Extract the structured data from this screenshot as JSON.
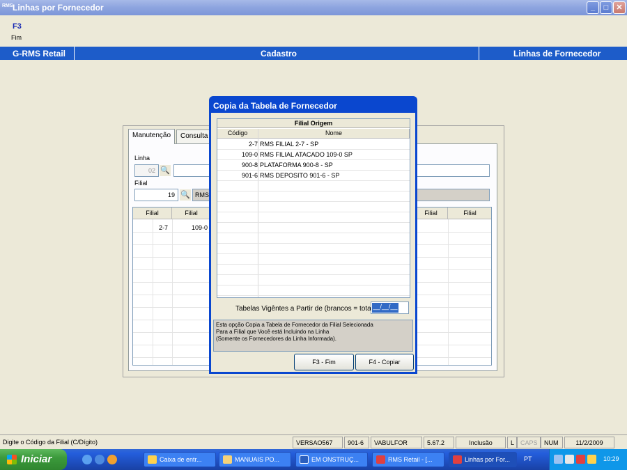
{
  "window": {
    "app_icon_text": "RMS",
    "title": "Linhas por Fornecedor",
    "minimize": "_",
    "maximize": "□",
    "close": "✕"
  },
  "function_key": {
    "key": "F3",
    "description": "Fim"
  },
  "header": {
    "left": "G-RMS Retail",
    "center": "Cadastro",
    "right": "Linhas de Fornecedor"
  },
  "tabs": [
    {
      "label": "Manutenção"
    },
    {
      "label": "Consulta L"
    }
  ],
  "form": {
    "linha_label": "Linha",
    "linha_value": "02",
    "filial_label": "Filial",
    "filial_value": "19",
    "filial_name": "RMS"
  },
  "grid": {
    "headers": [
      "Filial",
      "Filial",
      "Filial",
      "Filial"
    ],
    "rows": [
      [
        "2-7",
        "109-0"
      ]
    ]
  },
  "dialog": {
    "title": "Copia da Tabela de Fornecedor",
    "group_header": "Filial Origem",
    "col_codigo": "Código",
    "col_nome": "Nome",
    "rows": [
      {
        "codigo": "2-7",
        "nome": "RMS FILIAL 2-7 - SP"
      },
      {
        "codigo": "109-0",
        "nome": "RMS FILIAL ATACADO 109-0 SP"
      },
      {
        "codigo": "900-8",
        "nome": "PLATAFORMA 900-8 - SP"
      },
      {
        "codigo": "901-6",
        "nome": "RMS DEPOSITO 901-6 - SP"
      }
    ],
    "vigentes_label": "Tabelas Vigêntes a Partir de (brancos = total)",
    "vigentes_value": "__/__/__",
    "message_lines": [
      "Esta opção Copia a Tabela de Fornecedor da Filial Selecionada",
      "Para a Filial que Você está Incluindo na Linha",
      "(Somente os Fornecedores da Linha Informada)."
    ],
    "btn_fim": "F3 - Fim",
    "btn_copiar": "F4 - Copiar"
  },
  "status_bar": {
    "hint": "Digite o Código da Filial (C/Dígito)",
    "versao": "VERSAO567",
    "filial": "901-6",
    "programa": "VABULFOR",
    "release": "5.67.2",
    "modo": "Inclusão",
    "l": "L",
    "caps": "CAPS",
    "num": "NUM",
    "date": "11/2/2009"
  },
  "taskbar": {
    "start_label": "Iniciar",
    "tasks": [
      {
        "label": "Caixa de entr..."
      },
      {
        "label": "MANUAIS PO..."
      },
      {
        "label": "EM ONSTRUÇ..."
      },
      {
        "label": "RMS Retail - [..."
      },
      {
        "label": "Linhas por For..."
      }
    ],
    "language": "PT",
    "clock": "10:29"
  },
  "colors": {
    "header_blue": "#1D5CC9",
    "dialog_blue": "#0A47CF",
    "background": "#ECE9D8"
  }
}
